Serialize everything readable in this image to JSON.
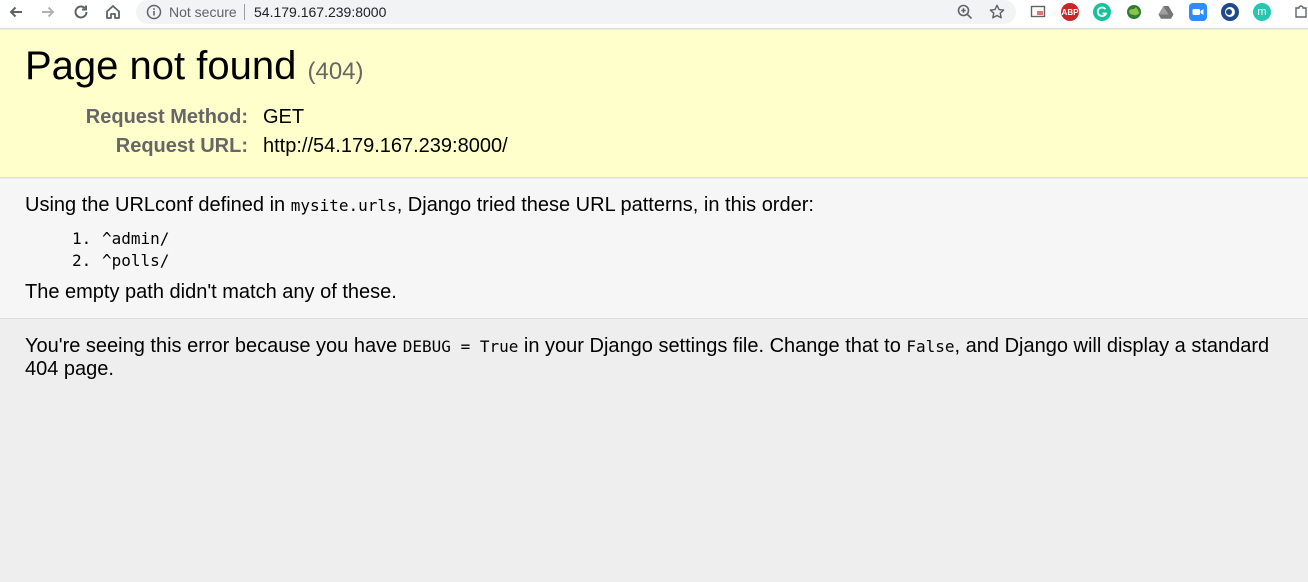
{
  "browser": {
    "security_label": "Not secure",
    "url": "54.179.167.239:8000",
    "extensions": [
      "cast-icon",
      "adblock-plus-icon",
      "grammarly-icon",
      "translate-globe-icon",
      "google-drive-icon",
      "zoom-icon",
      "circle-extension-icon",
      "m-extension-icon",
      "puzzle-icon"
    ],
    "extension_texts": {
      "abp": "ABP",
      "m": "m"
    }
  },
  "summary": {
    "title": "Page not found",
    "status_code": "(404)",
    "request_method_label": "Request Method:",
    "request_method_value": "GET",
    "request_url_label": "Request URL:",
    "request_url_value": "http://54.179.167.239:8000/"
  },
  "info": {
    "intro_prefix": "Using the URLconf defined in ",
    "urlconf": "mysite.urls",
    "intro_suffix": ", Django tried these URL patterns, in this order:",
    "patterns": [
      {
        "num": "1.",
        "pattern": "^admin/"
      },
      {
        "num": "2.",
        "pattern": "^polls/"
      }
    ],
    "outro": "The empty path didn't match any of these."
  },
  "explanation": {
    "part1": "You're seeing this error because you have ",
    "code1": "DEBUG = True",
    "part2": " in your Django settings file. Change that to ",
    "code2": "False",
    "part3": ", and Django will display a standard 404 page."
  },
  "colors": {
    "summary_bg": "#ffffcc",
    "info_bg": "#f6f6f6",
    "explanation_bg": "#eeeeee",
    "label_gray": "#666666"
  }
}
